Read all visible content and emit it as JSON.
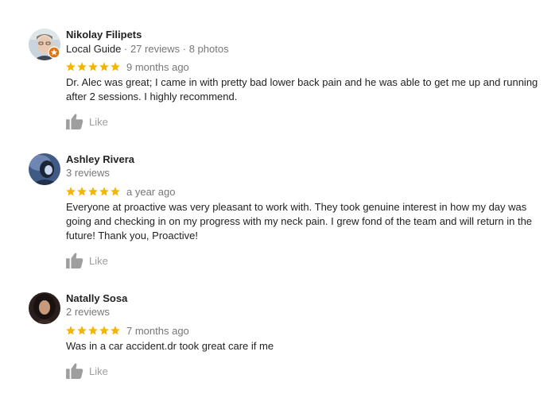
{
  "colors": {
    "star": "#f4b400",
    "like_icon": "#9e9e9e",
    "meta_text": "#777777",
    "local_guide_badge": "#e8710a"
  },
  "reviews": [
    {
      "name": "Nikolay Filipets",
      "local_guide": "Local Guide",
      "reviews_count": "27 reviews",
      "photos_count": "8 photos",
      "separator": "·",
      "rating": 5,
      "time": "9 months ago",
      "text": "Dr. Alec was great; I came in with pretty bad lower back pain and he was able to get me up and running after 2 sessions. I highly recommend.",
      "like_label": "Like"
    },
    {
      "name": "Ashley Rivera",
      "reviews_count": "3 reviews",
      "rating": 5,
      "time": "a year ago",
      "text": "Everyone at proactive was very pleasant to work with. They took genuine interest in how my day was going and checking in on my progress with my neck pain. I grew fond of the team and will return in the future! Thank you, Proactive!",
      "like_label": "Like"
    },
    {
      "name": "Natally Sosa",
      "reviews_count": "2 reviews",
      "rating": 5,
      "time": "7 months ago",
      "text": "Was in a car accident.dr took great care if me",
      "like_label": "Like"
    }
  ]
}
